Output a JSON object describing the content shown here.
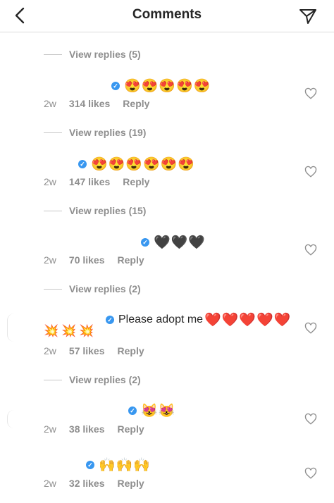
{
  "header": {
    "title": "Comments"
  },
  "comments": [
    {
      "view_replies": "View replies (5)",
      "emoji": "😍😍😍😍😍",
      "time": "2w",
      "likes": "314 likes",
      "reply": "Reply"
    },
    {
      "view_replies": "View replies (19)",
      "emoji": "😍😍😍😍😍😍",
      "time": "2w",
      "likes": "147 likes",
      "reply": "Reply"
    },
    {
      "view_replies": "View replies (15)",
      "emoji": "🖤🖤🖤",
      "time": "2w",
      "likes": "70 likes",
      "reply": "Reply"
    },
    {
      "view_replies": "View replies (2)",
      "text": "Please adopt me",
      "emoji": "❤️❤️❤️❤️❤️",
      "emoji_line2": "💥💥💥",
      "time": "2w",
      "likes": "57 likes",
      "reply": "Reply"
    },
    {
      "view_replies": "View replies (2)",
      "emoji": "😻😻",
      "time": "2w",
      "likes": "38 likes",
      "reply": "Reply"
    },
    {
      "emoji": "🙌🙌🙌",
      "time": "2w",
      "likes": "32 likes",
      "reply": "Reply"
    }
  ],
  "icons": {
    "back": "chevron-left-icon",
    "send": "paper-plane-icon",
    "like": "heart-outline-icon",
    "verified": "verified-badge-icon"
  },
  "colors": {
    "verified": "#3897f0",
    "muted": "#8e8e8e"
  }
}
